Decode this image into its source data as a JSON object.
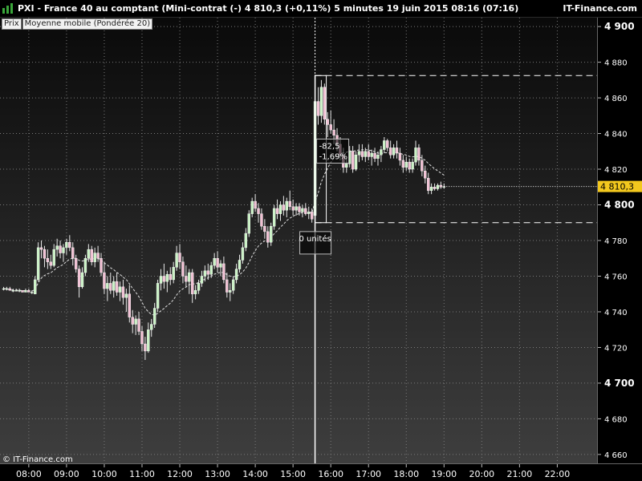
{
  "header": {
    "title": "PXI - France 40 au comptant (Mini-contrat  (-)    4 810,3 (+0,11%)     5 minutes  19 juin 2015 08:16 (07:16)",
    "brand": "IT-Finance.com"
  },
  "legend": {
    "price_tag": "Prix",
    "indicator": "Moyenne mobile (Pondérée 20)"
  },
  "copyright": "© IT-Finance.com",
  "colors": {
    "bullish": "#c9f3c4",
    "bearish": "#f2bfd3",
    "bar_outline": "#e8e8e8",
    "grid": "#7a7a7a",
    "last_price_bg": "#f3c81e",
    "cursor": "#ffffff",
    "ma_line": "#e0e0e0"
  },
  "cursor_box": {
    "label_top": "-82,5",
    "label_bottom": "-1,69%",
    "units": "0 unités"
  },
  "chart_data": {
    "type": "candlestick",
    "instrument": "PXI - France 40 au comptant (Mini-contrat",
    "interval": "5 minutes",
    "y_ticks": [
      "4 900",
      "4 880",
      "4 860",
      "4 840",
      "4 820",
      "4 800",
      "4 780",
      "4 760",
      "4 740",
      "4 720",
      "4 700",
      "4 680",
      "4 660"
    ],
    "ylim": [
      4655,
      4905
    ],
    "last_price": "4 810,3",
    "x_ticks": [
      "08:00",
      "09:00",
      "10:00",
      "11:00",
      "12:00",
      "13:00",
      "14:00",
      "15:00",
      "16:00",
      "17:00",
      "18:00",
      "19:00",
      "20:00",
      "21:00",
      "22:00"
    ],
    "grid": true,
    "indicator": "Moyenne mobile (Pondérée 20)",
    "measure": {
      "high_level": 4872.5,
      "low_level": 4790.0,
      "change": "-82,5",
      "change_pct": "-1,69%",
      "units": "0 unités"
    },
    "series": [
      {
        "index": 0,
        "o": 4753,
        "h": 4754,
        "l": 4752,
        "c": 4753
      },
      {
        "index": 1,
        "o": 4753,
        "h": 4754,
        "l": 4752,
        "c": 4753
      },
      {
        "index": 2,
        "o": 4753,
        "h": 4754,
        "l": 4752,
        "c": 4752
      },
      {
        "index": 3,
        "o": 4752,
        "h": 4753,
        "l": 4751,
        "c": 4752
      },
      {
        "index": 4,
        "o": 4752,
        "h": 4753,
        "l": 4752,
        "c": 4752
      },
      {
        "index": 5,
        "o": 4752,
        "h": 4753,
        "l": 4751,
        "c": 4752
      },
      {
        "index": 6,
        "o": 4752,
        "h": 4752,
        "l": 4751,
        "c": 4751
      },
      {
        "index": 7,
        "o": 4751,
        "h": 4753,
        "l": 4751,
        "c": 4752
      },
      {
        "index": 8,
        "o": 4752,
        "h": 4753,
        "l": 4751,
        "c": 4751
      },
      {
        "index": 9,
        "o": 4751,
        "h": 4752,
        "l": 4750,
        "c": 4751
      },
      {
        "index": 10,
        "o": 4750,
        "h": 4760,
        "l": 4750,
        "c": 4758
      },
      {
        "index": 11,
        "o": 4758,
        "h": 4779,
        "l": 4757,
        "c": 4776
      },
      {
        "index": 12,
        "o": 4776,
        "h": 4780,
        "l": 4770,
        "c": 4775
      },
      {
        "index": 13,
        "o": 4775,
        "h": 4777,
        "l": 4765,
        "c": 4770
      },
      {
        "index": 14,
        "o": 4770,
        "h": 4775,
        "l": 4764,
        "c": 4768
      },
      {
        "index": 15,
        "o": 4768,
        "h": 4772,
        "l": 4764,
        "c": 4766
      },
      {
        "index": 16,
        "o": 4766,
        "h": 4778,
        "l": 4765,
        "c": 4775
      },
      {
        "index": 17,
        "o": 4775,
        "h": 4781,
        "l": 4771,
        "c": 4777
      },
      {
        "index": 18,
        "o": 4777,
        "h": 4780,
        "l": 4770,
        "c": 4773
      },
      {
        "index": 19,
        "o": 4773,
        "h": 4778,
        "l": 4768,
        "c": 4776
      },
      {
        "index": 20,
        "o": 4776,
        "h": 4781,
        "l": 4772,
        "c": 4779
      },
      {
        "index": 21,
        "o": 4779,
        "h": 4783,
        "l": 4774,
        "c": 4776
      },
      {
        "index": 22,
        "o": 4776,
        "h": 4779,
        "l": 4766,
        "c": 4770
      },
      {
        "index": 23,
        "o": 4770,
        "h": 4772,
        "l": 4762,
        "c": 4764
      },
      {
        "index": 24,
        "o": 4764,
        "h": 4766,
        "l": 4748,
        "c": 4754
      },
      {
        "index": 25,
        "o": 4754,
        "h": 4765,
        "l": 4753,
        "c": 4762
      },
      {
        "index": 26,
        "o": 4762,
        "h": 4772,
        "l": 4760,
        "c": 4770
      },
      {
        "index": 27,
        "o": 4770,
        "h": 4778,
        "l": 4768,
        "c": 4775
      },
      {
        "index": 28,
        "o": 4775,
        "h": 4777,
        "l": 4766,
        "c": 4768
      },
      {
        "index": 29,
        "o": 4768,
        "h": 4776,
        "l": 4765,
        "c": 4773
      },
      {
        "index": 30,
        "o": 4773,
        "h": 4777,
        "l": 4768,
        "c": 4770
      },
      {
        "index": 31,
        "o": 4770,
        "h": 4773,
        "l": 4760,
        "c": 4762
      },
      {
        "index": 32,
        "o": 4762,
        "h": 4768,
        "l": 4750,
        "c": 4753
      },
      {
        "index": 33,
        "o": 4753,
        "h": 4760,
        "l": 4746,
        "c": 4756
      },
      {
        "index": 34,
        "o": 4756,
        "h": 4762,
        "l": 4750,
        "c": 4752
      },
      {
        "index": 35,
        "o": 4752,
        "h": 4760,
        "l": 4748,
        "c": 4757
      },
      {
        "index": 36,
        "o": 4757,
        "h": 4762,
        "l": 4749,
        "c": 4751
      },
      {
        "index": 37,
        "o": 4751,
        "h": 4757,
        "l": 4746,
        "c": 4754
      },
      {
        "index": 38,
        "o": 4754,
        "h": 4758,
        "l": 4744,
        "c": 4748
      },
      {
        "index": 39,
        "o": 4748,
        "h": 4753,
        "l": 4740,
        "c": 4750
      },
      {
        "index": 40,
        "o": 4750,
        "h": 4755,
        "l": 4734,
        "c": 4737
      },
      {
        "index": 41,
        "o": 4737,
        "h": 4741,
        "l": 4728,
        "c": 4733
      },
      {
        "index": 42,
        "o": 4733,
        "h": 4738,
        "l": 4727,
        "c": 4736
      },
      {
        "index": 43,
        "o": 4736,
        "h": 4740,
        "l": 4727,
        "c": 4729
      },
      {
        "index": 44,
        "o": 4729,
        "h": 4732,
        "l": 4718,
        "c": 4722
      },
      {
        "index": 45,
        "o": 4722,
        "h": 4726,
        "l": 4713,
        "c": 4718
      },
      {
        "index": 46,
        "o": 4718,
        "h": 4734,
        "l": 4717,
        "c": 4730
      },
      {
        "index": 47,
        "o": 4730,
        "h": 4736,
        "l": 4726,
        "c": 4733
      },
      {
        "index": 48,
        "o": 4733,
        "h": 4745,
        "l": 4731,
        "c": 4742
      },
      {
        "index": 49,
        "o": 4742,
        "h": 4758,
        "l": 4740,
        "c": 4756
      },
      {
        "index": 50,
        "o": 4756,
        "h": 4764,
        "l": 4752,
        "c": 4760
      },
      {
        "index": 51,
        "o": 4760,
        "h": 4767,
        "l": 4753,
        "c": 4757
      },
      {
        "index": 52,
        "o": 4757,
        "h": 4763,
        "l": 4751,
        "c": 4761
      },
      {
        "index": 53,
        "o": 4761,
        "h": 4765,
        "l": 4755,
        "c": 4758
      },
      {
        "index": 54,
        "o": 4758,
        "h": 4768,
        "l": 4756,
        "c": 4765
      },
      {
        "index": 55,
        "o": 4765,
        "h": 4777,
        "l": 4763,
        "c": 4773
      },
      {
        "index": 56,
        "o": 4773,
        "h": 4778,
        "l": 4764,
        "c": 4768
      },
      {
        "index": 57,
        "o": 4768,
        "h": 4771,
        "l": 4756,
        "c": 4760
      },
      {
        "index": 58,
        "o": 4760,
        "h": 4766,
        "l": 4754,
        "c": 4757
      },
      {
        "index": 59,
        "o": 4757,
        "h": 4764,
        "l": 4750,
        "c": 4762
      },
      {
        "index": 60,
        "o": 4762,
        "h": 4764,
        "l": 4745,
        "c": 4750
      },
      {
        "index": 61,
        "o": 4750,
        "h": 4755,
        "l": 4747,
        "c": 4752
      },
      {
        "index": 62,
        "o": 4752,
        "h": 4758,
        "l": 4750,
        "c": 4756
      },
      {
        "index": 63,
        "o": 4756,
        "h": 4763,
        "l": 4754,
        "c": 4760
      },
      {
        "index": 64,
        "o": 4760,
        "h": 4766,
        "l": 4757,
        "c": 4763
      },
      {
        "index": 65,
        "o": 4763,
        "h": 4767,
        "l": 4758,
        "c": 4761
      },
      {
        "index": 66,
        "o": 4761,
        "h": 4768,
        "l": 4759,
        "c": 4766
      },
      {
        "index": 67,
        "o": 4766,
        "h": 4773,
        "l": 4764,
        "c": 4770
      },
      {
        "index": 68,
        "o": 4770,
        "h": 4774,
        "l": 4762,
        "c": 4765
      },
      {
        "index": 69,
        "o": 4765,
        "h": 4769,
        "l": 4760,
        "c": 4767
      },
      {
        "index": 70,
        "o": 4767,
        "h": 4771,
        "l": 4756,
        "c": 4758
      },
      {
        "index": 71,
        "o": 4758,
        "h": 4762,
        "l": 4748,
        "c": 4751
      },
      {
        "index": 72,
        "o": 4751,
        "h": 4756,
        "l": 4746,
        "c": 4752
      },
      {
        "index": 73,
        "o": 4752,
        "h": 4760,
        "l": 4750,
        "c": 4758
      },
      {
        "index": 74,
        "o": 4758,
        "h": 4767,
        "l": 4756,
        "c": 4764
      },
      {
        "index": 75,
        "o": 4764,
        "h": 4772,
        "l": 4762,
        "c": 4769
      },
      {
        "index": 76,
        "o": 4769,
        "h": 4779,
        "l": 4767,
        "c": 4776
      },
      {
        "index": 77,
        "o": 4776,
        "h": 4787,
        "l": 4774,
        "c": 4784
      },
      {
        "index": 78,
        "o": 4784,
        "h": 4797,
        "l": 4782,
        "c": 4795
      },
      {
        "index": 79,
        "o": 4795,
        "h": 4804,
        "l": 4793,
        "c": 4802
      },
      {
        "index": 80,
        "o": 4802,
        "h": 4806,
        "l": 4796,
        "c": 4798
      },
      {
        "index": 81,
        "o": 4798,
        "h": 4801,
        "l": 4790,
        "c": 4795
      },
      {
        "index": 82,
        "o": 4795,
        "h": 4798,
        "l": 4786,
        "c": 4788
      },
      {
        "index": 83,
        "o": 4788,
        "h": 4792,
        "l": 4781,
        "c": 4785
      },
      {
        "index": 84,
        "o": 4785,
        "h": 4788,
        "l": 4776,
        "c": 4779
      },
      {
        "index": 85,
        "o": 4779,
        "h": 4790,
        "l": 4777,
        "c": 4788
      },
      {
        "index": 86,
        "o": 4788,
        "h": 4800,
        "l": 4786,
        "c": 4798
      },
      {
        "index": 87,
        "o": 4798,
        "h": 4803,
        "l": 4792,
        "c": 4795
      },
      {
        "index": 88,
        "o": 4795,
        "h": 4802,
        "l": 4791,
        "c": 4800
      },
      {
        "index": 89,
        "o": 4800,
        "h": 4805,
        "l": 4794,
        "c": 4797
      },
      {
        "index": 90,
        "o": 4797,
        "h": 4804,
        "l": 4793,
        "c": 4802
      },
      {
        "index": 91,
        "o": 4802,
        "h": 4808,
        "l": 4797,
        "c": 4799
      },
      {
        "index": 92,
        "o": 4799,
        "h": 4803,
        "l": 4794,
        "c": 4797
      },
      {
        "index": 93,
        "o": 4797,
        "h": 4801,
        "l": 4794,
        "c": 4799
      },
      {
        "index": 94,
        "o": 4799,
        "h": 4801,
        "l": 4794,
        "c": 4796
      },
      {
        "index": 95,
        "o": 4796,
        "h": 4800,
        "l": 4793,
        "c": 4798
      },
      {
        "index": 96,
        "o": 4798,
        "h": 4801,
        "l": 4794,
        "c": 4795
      },
      {
        "index": 97,
        "o": 4795,
        "h": 4799,
        "l": 4792,
        "c": 4796
      },
      {
        "index": 98,
        "o": 4796,
        "h": 4798,
        "l": 4790,
        "c": 4792
      },
      {
        "index": 99,
        "o": 4794,
        "h": 4873,
        "l": 4793,
        "c": 4858
      },
      {
        "index": 100,
        "o": 4858,
        "h": 4866,
        "l": 4845,
        "c": 4850
      },
      {
        "index": 101,
        "o": 4850,
        "h": 4870,
        "l": 4846,
        "c": 4866
      },
      {
        "index": 102,
        "o": 4866,
        "h": 4868,
        "l": 4845,
        "c": 4848
      },
      {
        "index": 103,
        "o": 4848,
        "h": 4852,
        "l": 4838,
        "c": 4845
      },
      {
        "index": 104,
        "o": 4845,
        "h": 4853,
        "l": 4840,
        "c": 4842
      },
      {
        "index": 105,
        "o": 4842,
        "h": 4848,
        "l": 4834,
        "c": 4839
      },
      {
        "index": 106,
        "o": 4839,
        "h": 4843,
        "l": 4830,
        "c": 4834
      },
      {
        "index": 107,
        "o": 4834,
        "h": 4838,
        "l": 4825,
        "c": 4828
      },
      {
        "index": 108,
        "o": 4828,
        "h": 4832,
        "l": 4818,
        "c": 4821
      },
      {
        "index": 109,
        "o": 4821,
        "h": 4826,
        "l": 4818,
        "c": 4823
      },
      {
        "index": 110,
        "o": 4823,
        "h": 4833,
        "l": 4821,
        "c": 4830
      },
      {
        "index": 111,
        "o": 4830,
        "h": 4833,
        "l": 4818,
        "c": 4820
      },
      {
        "index": 112,
        "o": 4820,
        "h": 4830,
        "l": 4819,
        "c": 4828
      },
      {
        "index": 113,
        "o": 4828,
        "h": 4834,
        "l": 4824,
        "c": 4830
      },
      {
        "index": 114,
        "o": 4830,
        "h": 4834,
        "l": 4825,
        "c": 4827
      },
      {
        "index": 115,
        "o": 4827,
        "h": 4832,
        "l": 4824,
        "c": 4830
      },
      {
        "index": 116,
        "o": 4830,
        "h": 4834,
        "l": 4825,
        "c": 4827
      },
      {
        "index": 117,
        "o": 4827,
        "h": 4831,
        "l": 4822,
        "c": 4829
      },
      {
        "index": 118,
        "o": 4829,
        "h": 4832,
        "l": 4824,
        "c": 4826
      },
      {
        "index": 119,
        "o": 4826,
        "h": 4830,
        "l": 4822,
        "c": 4828
      },
      {
        "index": 120,
        "o": 4828,
        "h": 4833,
        "l": 4824,
        "c": 4831
      },
      {
        "index": 121,
        "o": 4831,
        "h": 4838,
        "l": 4829,
        "c": 4836
      },
      {
        "index": 122,
        "o": 4836,
        "h": 4837,
        "l": 4830,
        "c": 4832
      },
      {
        "index": 123,
        "o": 4832,
        "h": 4836,
        "l": 4826,
        "c": 4828
      },
      {
        "index": 124,
        "o": 4828,
        "h": 4834,
        "l": 4826,
        "c": 4832
      },
      {
        "index": 125,
        "o": 4832,
        "h": 4836,
        "l": 4826,
        "c": 4829
      },
      {
        "index": 126,
        "o": 4829,
        "h": 4832,
        "l": 4822,
        "c": 4825
      },
      {
        "index": 127,
        "o": 4825,
        "h": 4828,
        "l": 4818,
        "c": 4821
      },
      {
        "index": 128,
        "o": 4821,
        "h": 4827,
        "l": 4819,
        "c": 4824
      },
      {
        "index": 129,
        "o": 4824,
        "h": 4826,
        "l": 4818,
        "c": 4820
      },
      {
        "index": 130,
        "o": 4820,
        "h": 4826,
        "l": 4818,
        "c": 4824
      },
      {
        "index": 131,
        "o": 4824,
        "h": 4836,
        "l": 4822,
        "c": 4832
      },
      {
        "index": 132,
        "o": 4832,
        "h": 4834,
        "l": 4822,
        "c": 4825
      },
      {
        "index": 133,
        "o": 4825,
        "h": 4828,
        "l": 4816,
        "c": 4819
      },
      {
        "index": 134,
        "o": 4819,
        "h": 4822,
        "l": 4812,
        "c": 4815
      },
      {
        "index": 135,
        "o": 4815,
        "h": 4818,
        "l": 4806,
        "c": 4808
      },
      {
        "index": 136,
        "o": 4808,
        "h": 4812,
        "l": 4806,
        "c": 4810
      },
      {
        "index": 137,
        "o": 4810,
        "h": 4812,
        "l": 4808,
        "c": 4809
      },
      {
        "index": 138,
        "o": 4809,
        "h": 4812,
        "l": 4808,
        "c": 4811
      },
      {
        "index": 139,
        "o": 4811,
        "h": 4813,
        "l": 4809,
        "c": 4810
      },
      {
        "index": 140,
        "o": 4810,
        "h": 4812,
        "l": 4809,
        "c": 4810.3
      }
    ]
  }
}
